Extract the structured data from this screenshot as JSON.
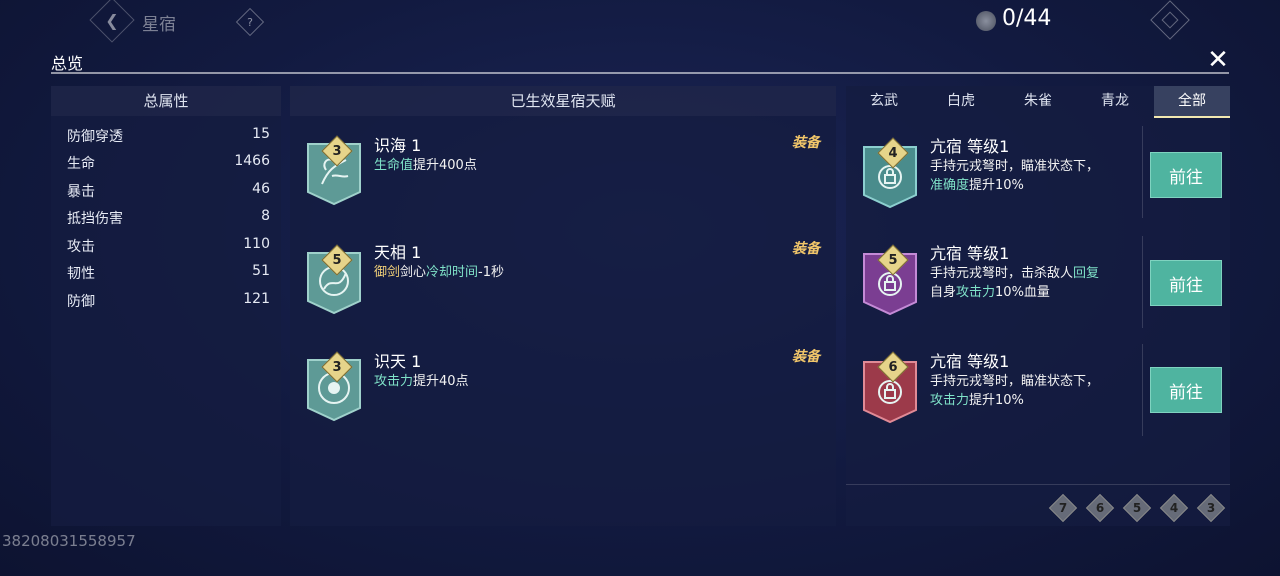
{
  "top": {
    "title": "星宿",
    "help": "?",
    "currency": "0/44"
  },
  "panel": {
    "title": "总览",
    "close": "✕"
  },
  "left": {
    "header": "总属性",
    "stats": [
      {
        "label": "防御穿透",
        "value": "15"
      },
      {
        "label": "生命",
        "value": "1466"
      },
      {
        "label": "暴击",
        "value": "46"
      },
      {
        "label": "抵挡伤害",
        "value": "8"
      },
      {
        "label": "攻击",
        "value": "110"
      },
      {
        "label": "韧性",
        "value": "51"
      },
      {
        "label": "防御",
        "value": "121"
      }
    ]
  },
  "middle": {
    "header": "已生效星宿天赋",
    "items": [
      {
        "level": "3",
        "name": "识海 1",
        "desc_a": "生命值",
        "desc_b": "提升400点",
        "tag": "装备",
        "icon": "sea-knowledge-icon"
      },
      {
        "level": "5",
        "name": "天相 1",
        "desc_a": "御剑",
        "desc_b": "剑心",
        "desc_c": "冷却时间",
        "desc_d": "-1秒",
        "tag": "装备",
        "icon": "sky-sign-icon"
      },
      {
        "level": "3",
        "name": "识天 1",
        "desc_a": "攻击力",
        "desc_b": "提升40点",
        "tag": "装备",
        "icon": "sky-knowledge-icon"
      }
    ]
  },
  "right": {
    "tabs": [
      "玄武",
      "白虎",
      "朱雀",
      "青龙",
      "全部"
    ],
    "active_tab": "全部",
    "items": [
      {
        "level": "4",
        "name": "亢宿 等级1",
        "line1": "手持元戎弩时，瞄准状态下，",
        "line2_a": "准确度",
        "line2_b": "提升10%",
        "button": "前往",
        "color": "#4a8c8c"
      },
      {
        "level": "5",
        "name": "亢宿 等级1",
        "line1_a": "手持元戎弩时，击杀敌人",
        "line1_b": "回复",
        "line2_a": "自身",
        "line2_b": "攻击力",
        "line2_c": "10%血量",
        "button": "前往",
        "color": "#7b3e92"
      },
      {
        "level": "6",
        "name": "亢宿 等级1",
        "line1": "手持元戎弩时，瞄准状态下，",
        "line2_a": "攻击力",
        "line2_b": "提升10%",
        "button": "前往",
        "color": "#9c3a4a"
      }
    ],
    "pages": [
      "7",
      "6",
      "5",
      "4",
      "3"
    ]
  },
  "uid": "38208031558957",
  "colors": {
    "accent": "#4fb4a0",
    "gold": "#f0cf78",
    "green": "#7fe2c8"
  }
}
